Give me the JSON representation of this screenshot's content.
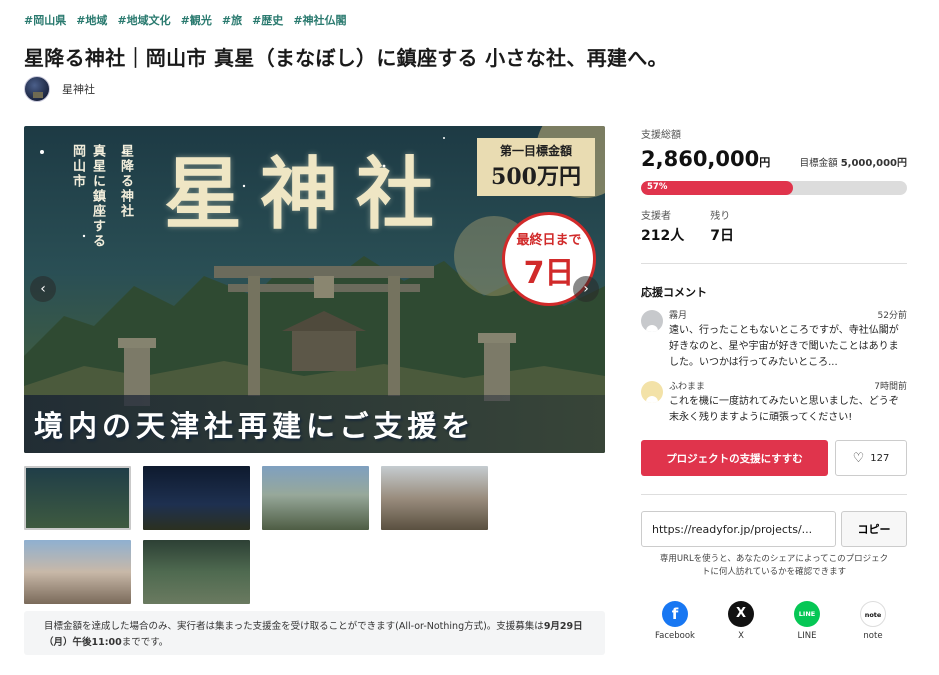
{
  "tags": [
    "#岡山県",
    "#地域",
    "#地域文化",
    "#観光",
    "#旅",
    "#歴史",
    "#神社仏閣"
  ],
  "title": "星降る神社｜岡山市 真星（まなぼし）に鎮座する 小さな社、再建へ。",
  "owner": {
    "name": "星神社"
  },
  "hero": {
    "vertical_1": "岡山市",
    "vertical_2": "真星に鎮座する",
    "vertical_3": "星降る神社",
    "big_title": "星神社",
    "goal_label": "第一目標金額",
    "goal_value": "500万円",
    "badge_line1": "最終日まで",
    "badge_line2": "7日",
    "banner": "境内の天津社再建にご支援を",
    "prev_icon": "chevron-left-icon",
    "next_icon": "chevron-right-icon"
  },
  "notice": {
    "text1": "目標金額を達成した場合のみ、実行者は集まった支援金を受け取ることができます(All-or-Nothing方式)。支援募集は",
    "date": "9月29日（月）午後11:00",
    "text2": "までです。"
  },
  "stats": {
    "total_label": "支援総額",
    "total_value": "2,860,000",
    "total_unit": "円",
    "goal_label": "目標金額",
    "goal_value": "5,000,000円",
    "progress_percent": 57,
    "progress_text": "57%",
    "supporters_label": "支援者",
    "supporters_value": "212人",
    "remaining_label": "残り",
    "remaining_value": "7日"
  },
  "comments": {
    "heading": "応援コメント",
    "items": [
      {
        "name": "霧月",
        "time": "52分前",
        "text": "遠い、行ったこともないところですが、寺社仏閣が好きなのと、星や宇宙が好きで聞いたことはありました。いつかは行ってみたいところ..."
      },
      {
        "name": "ふわまま",
        "time": "7時間前",
        "text": "これを機に一度訪れてみたいと思いました、どうぞ末永く残りますように頑張ってください!"
      }
    ]
  },
  "actions": {
    "support_label": "プロジェクトの支援にすすむ",
    "like_count": "127",
    "like_icon": "heart-icon"
  },
  "share_url": {
    "value": "https://readyfor.jp/projects/...",
    "copy_label": "コピー",
    "note": "専用URLを使うと、あなたのシェアによってこのプロジェクトに何人訪れているかを確認できます"
  },
  "share": [
    {
      "label": "Facebook",
      "icon_text": "f",
      "icon": "facebook-icon"
    },
    {
      "label": "X",
      "icon_text": "X",
      "icon": "x-icon"
    },
    {
      "label": "LINE",
      "icon_text": "LINE",
      "icon": "line-icon"
    },
    {
      "label": "note",
      "icon_text": "note",
      "icon": "note-icon"
    }
  ],
  "colors": {
    "accent": "#e0344c",
    "tag": "#2a7a6f"
  }
}
